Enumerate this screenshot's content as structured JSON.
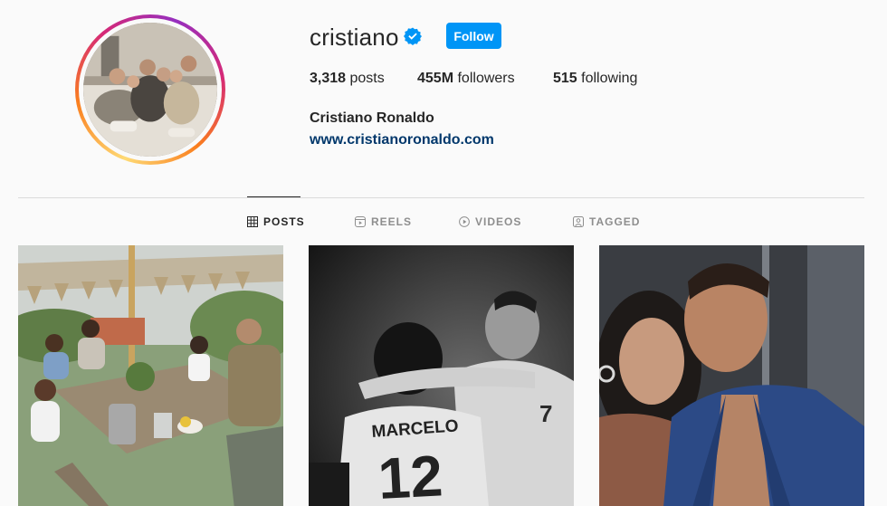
{
  "profile": {
    "username": "cristiano",
    "verified": true,
    "follow_label": "Follow",
    "full_name": "Cristiano Ronaldo",
    "website": "www.cristianoronaldo.com"
  },
  "stats": {
    "posts_count": "3,318",
    "posts_label": "posts",
    "followers_count": "455M",
    "followers_label": "followers",
    "following_count": "515",
    "following_label": "following"
  },
  "tabs": [
    {
      "label": "POSTS",
      "icon": "grid-icon",
      "active": true
    },
    {
      "label": "REELS",
      "icon": "reels-icon",
      "active": false
    },
    {
      "label": "VIDEOS",
      "icon": "play-circle-icon",
      "active": false
    },
    {
      "label": "TAGGED",
      "icon": "tagged-icon",
      "active": false
    }
  ],
  "posts": [
    {
      "kind": "family-outdoor-dinner-photo"
    },
    {
      "kind": "football-players-embrace-bw-photo"
    },
    {
      "kind": "couple-selfie-photo"
    }
  ],
  "colors": {
    "accent": "#0095f6",
    "link": "#00376b",
    "text": "#262626",
    "muted": "#8e8e8e",
    "background": "#fafafa",
    "divider": "#dbdbdb"
  }
}
